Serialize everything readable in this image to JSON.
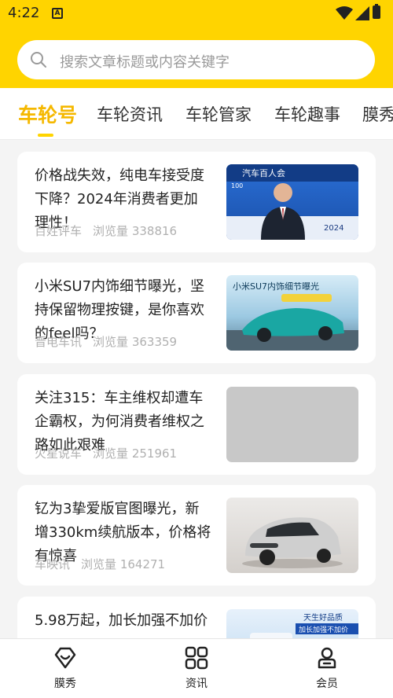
{
  "status_bar": {
    "time": "4:22",
    "sim_icon": "sim-card-icon",
    "wifi_icon": "wifi-icon",
    "signal_icon": "signal-icon",
    "battery_icon": "battery-icon"
  },
  "search": {
    "placeholder": "搜索文章标题或内容关键字",
    "icon": "search-icon"
  },
  "tabs": [
    {
      "label": "车轮号",
      "active": true
    },
    {
      "label": "车轮资讯",
      "active": false
    },
    {
      "label": "车轮管家",
      "active": false
    },
    {
      "label": "车轮趣事",
      "active": false
    },
    {
      "label": "膜秀",
      "active": false
    }
  ],
  "articles": [
    {
      "title": "价格战失效，纯电车接受度下降？2024年消费者更加理性！",
      "source": "百姓评车",
      "views_label": "浏览量",
      "views": "338816",
      "thumb_text": [
        "汽车百人会",
        "100",
        "2024"
      ]
    },
    {
      "title": "小米SU7内饰细节曝光，坚持保留物理按键，是你喜欢的feel吗？",
      "source": "晋电车讯",
      "views_label": "浏览量",
      "views": "363359",
      "thumb_text": [
        "小米SU7内饰细节曝光"
      ]
    },
    {
      "title": "关注315：车主维权却遭车企霸权，为何消费者维权之路如此艰难",
      "source": "火星说车",
      "views_label": "浏览量",
      "views": "251961",
      "thumb_text": []
    },
    {
      "title": "钇为3挚爱版官图曝光，新增330km续航版本，价格将有惊喜",
      "source": "车映讯",
      "views_label": "浏览量",
      "views": "164271",
      "thumb_text": []
    },
    {
      "title": "5.98万起，加长加强不加价",
      "source": "",
      "views_label": "",
      "views": "",
      "thumb_text": [
        "天生好品质",
        "加长加强不加价"
      ]
    }
  ],
  "bottom_nav": [
    {
      "label": "膜秀",
      "icon": "diamond-heart-icon"
    },
    {
      "label": "资讯",
      "icon": "grid-icon"
    },
    {
      "label": "会员",
      "icon": "member-icon"
    }
  ],
  "colors": {
    "brand_yellow": "#ffd400",
    "active_tab": "#f5b800",
    "meta_gray": "#b0b0b0"
  }
}
